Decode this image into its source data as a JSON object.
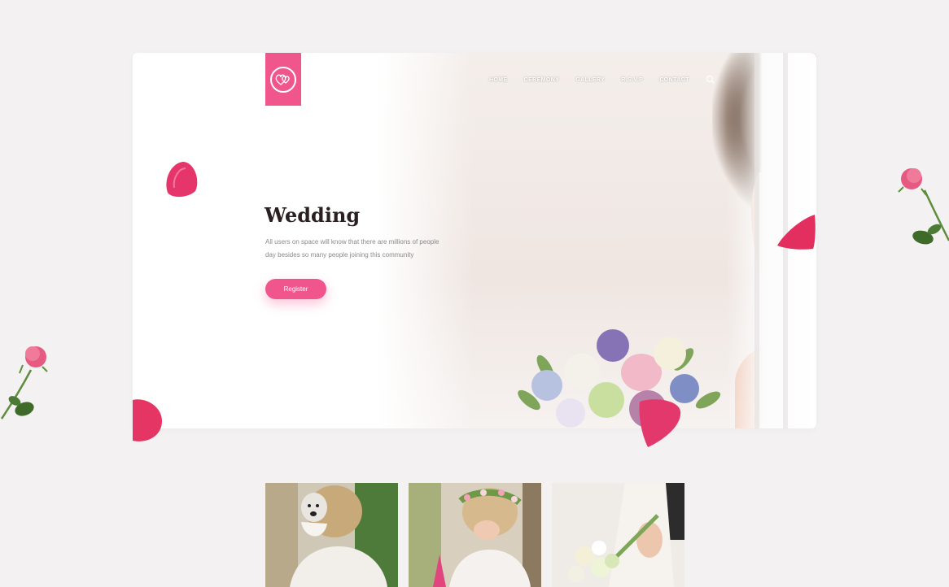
{
  "brand": {
    "logo": "wedding-hearts-logo",
    "accent": "#f0568c"
  },
  "nav": {
    "items": [
      {
        "label": "HOME"
      },
      {
        "label": "CEREMONY"
      },
      {
        "label": "GALLERY"
      },
      {
        "label": "R.S.V.P"
      },
      {
        "label": "CONTACT"
      }
    ],
    "search_icon": "search-icon"
  },
  "hero": {
    "title": "Wedding",
    "description": "All users on space will know that there are millions of people day besides so many people joining this community",
    "button_label": "Register"
  },
  "gallery": {
    "thumbnails": [
      {
        "subject": "bride-with-dog"
      },
      {
        "subject": "bride-flower-crown"
      },
      {
        "subject": "bride-bouquet"
      }
    ]
  }
}
